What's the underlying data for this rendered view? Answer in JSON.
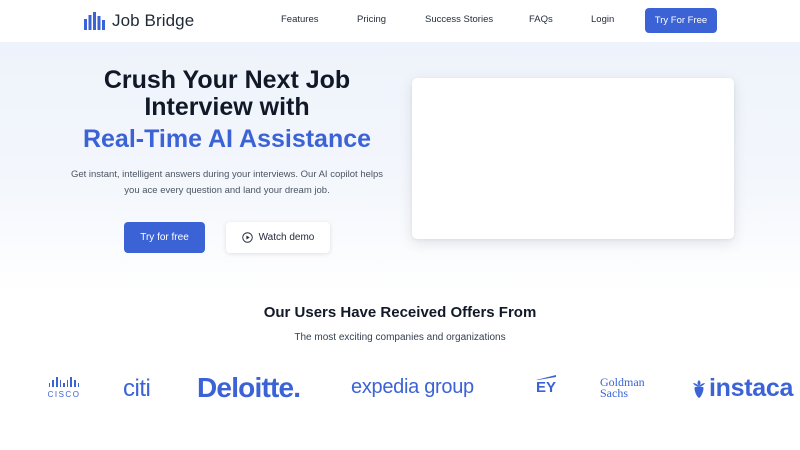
{
  "brand": {
    "name": "Job Bridge"
  },
  "nav": {
    "links": [
      "Features",
      "Pricing",
      "Success Stories",
      "FAQs",
      "Login"
    ],
    "cta": "Try For Free"
  },
  "hero": {
    "title_line1": "Crush Your Next Job",
    "title_line2": "Interview with",
    "title_highlight": "Real-Time AI Assistance",
    "description_line1": "Get instant, intelligent answers during your interviews. Our AI copilot helps",
    "description_line2": "you ace every question and land your dream job.",
    "primary_button": "Try for free",
    "secondary_button": "Watch demo"
  },
  "offers": {
    "title": "Our Users Have Received Offers From",
    "subtitle": "The most exciting companies and organizations",
    "logos": [
      "CISCO",
      "citi",
      "Deloitte.",
      "expedia group",
      "EY",
      "Goldman",
      "Sachs",
      "instaca"
    ]
  },
  "colors": {
    "accent": "#3b63d6",
    "text": "#111827",
    "muted": "#4b5563"
  }
}
